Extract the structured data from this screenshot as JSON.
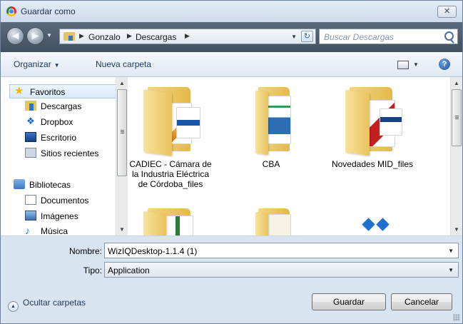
{
  "window": {
    "title": "Guardar como",
    "close_label": "✕"
  },
  "address": {
    "crumbs": [
      "Gonzalo",
      "Descargas"
    ],
    "search_placeholder": "Buscar Descargas"
  },
  "toolbar": {
    "organize": "Organizar",
    "new_folder": "Nueva carpeta"
  },
  "nav": {
    "favorites_header": "Favoritos",
    "favorites": [
      "Descargas",
      "Dropbox",
      "Escritorio",
      "Sitios recientes"
    ],
    "libraries_header": "Bibliotecas",
    "libraries": [
      "Documentos",
      "Imágenes",
      "Música"
    ]
  },
  "files": [
    {
      "name": "CADIEC - Cámara de la Industria Eléctrica de Córdoba_files"
    },
    {
      "name": "CBA"
    },
    {
      "name": "Novedades MID_files"
    }
  ],
  "form": {
    "name_label": "Nombre:",
    "name_value": "WizIQDesktop-1.1.4 (1)",
    "type_label": "Tipo:",
    "type_value": "Application"
  },
  "footer": {
    "hide_folders": "Ocultar carpetas",
    "save": "Guardar",
    "cancel": "Cancelar"
  },
  "colors": {
    "titlebar": "#d6e2f0",
    "addressbar": "#4f5f70",
    "selected_nav": "#dbeafc"
  }
}
